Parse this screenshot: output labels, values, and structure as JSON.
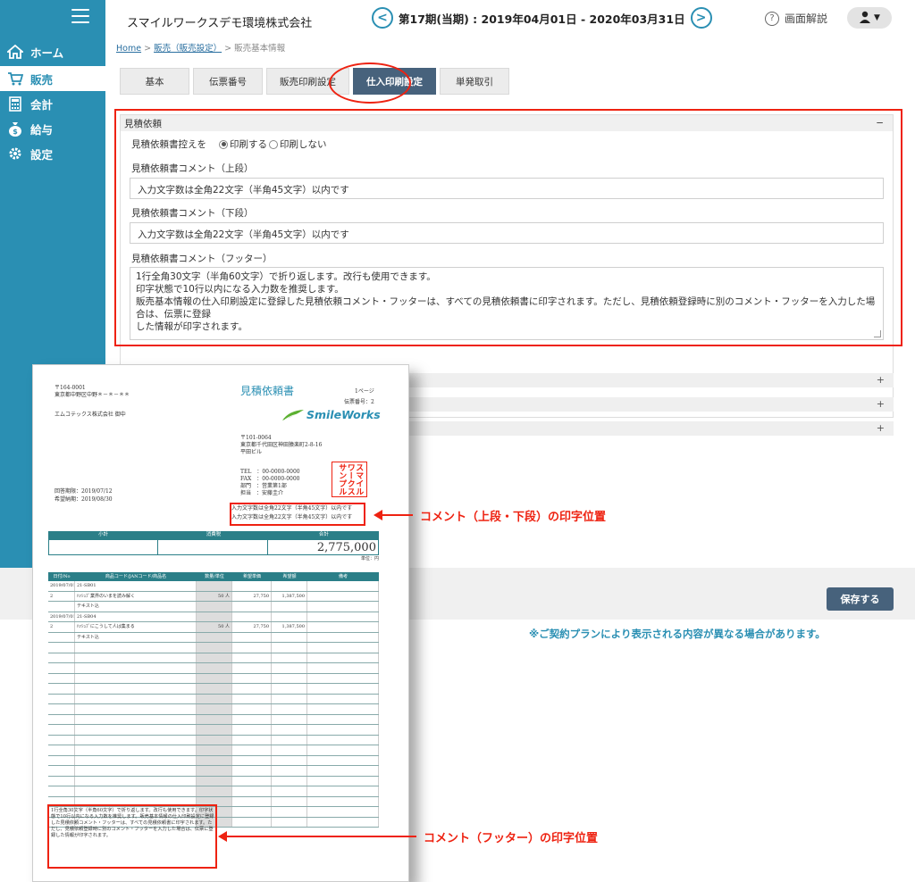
{
  "company": "スマイルワークスデモ環境株式会社",
  "period": {
    "prev_symbol": "<",
    "next_symbol": ">",
    "text": "第17期(当期) : 2019年04月01日 - 2020年03月31日"
  },
  "help_label": "画面解説",
  "sidebar": {
    "items": [
      {
        "label": "ホーム",
        "icon": "home-icon"
      },
      {
        "label": "販売",
        "icon": "cart-icon"
      },
      {
        "label": "会計",
        "icon": "calculator-icon"
      },
      {
        "label": "給与",
        "icon": "money-bag-icon"
      },
      {
        "label": "設定",
        "icon": "gear-icon"
      }
    ]
  },
  "breadcrumb": {
    "home": "Home",
    "sep": ">",
    "sales_settings": "販売（販売設定）",
    "current": "販売基本情報"
  },
  "tabs": [
    "基本",
    "伝票番号",
    "販売印刷設定",
    "仕入印刷設定",
    "単発取引"
  ],
  "section": {
    "title": "見積依頼",
    "collapse_symbol": "−",
    "print_copy_label": "見積依頼書控えを",
    "radio_print": "印刷する",
    "radio_noprint": "印刷しない",
    "comment_top_label": "見積依頼書コメント（上段）",
    "comment_top_value": "入力文字数は全角22文字（半角45文字）以内です",
    "comment_bottom_label": "見積依頼書コメント（下段）",
    "comment_bottom_value": "入力文字数は全角22文字（半角45文字）以内です",
    "footer_label": "見積依頼書コメント（フッター）",
    "footer_lines": [
      "1行全角30文字（半角60文字）で折り返します。改行も使用できます。",
      "印字状態で10行以内になる入力数を推奨します。",
      "販売基本情報の仕入印刷設定に登録した見積依頼コメント・フッターは、すべての見積依頼書に印字されます。ただし、見積依頼登録時に別のコメント・フッターを入力した場合は、伝票に登録",
      "した情報が印字されます。"
    ]
  },
  "expand_symbol": "+",
  "save_label": "保存する",
  "note": "※ご契約プランにより表示される内容が異なる場合があります。",
  "doc": {
    "zip_left": "〒164-0001",
    "addr_left": "東京都中野区中野＊－＊－＊＊",
    "client": "エムコテックス株式会社 御中",
    "title": "見積依頼書",
    "page": "1ページ",
    "slip_no": "伝票番号：2",
    "logo": "SmileWorks",
    "zip_right": "〒101-0064",
    "addr_right": "東京都千代田区神田猿楽町2-8-16",
    "bldg": "平田ビル",
    "tel": "TEL　：00-0000-0000",
    "fax": "FAX　：00-0000-0000",
    "dept": "部門　：営業第1部",
    "staff": "担当　：安藤圭介",
    "stamp": "スマイルワークスサンプル",
    "reply_date": "回答期限：2019/07/12",
    "desired_date": "希望納期：2019/08/30",
    "comment1": "入力文字数は全角22文字（半角45文字）以内です",
    "comment2": "入力文字数は全角22文字（半角45文字）以内です",
    "sum_headers": [
      "小計",
      "消費税",
      "合計"
    ],
    "total": "2,775,000",
    "unit": "単位：円",
    "detail_headers": [
      "日付/No",
      "商品コード/JANコード/商品名",
      "数量/単位",
      "希望単価",
      "希望額",
      "備考"
    ],
    "rows": [
      [
        "2019/07/01",
        "21-SB01",
        "",
        "",
        "",
        ""
      ],
      [
        "2",
        "ﾊｯｼｭﾌﾞ業界のいまを読み解く",
        "50 人",
        "27,750",
        "1,387,500",
        ""
      ],
      [
        "",
        "テキスト込",
        "",
        "",
        "",
        ""
      ],
      [
        "2019/07/01",
        "21-SB04",
        "",
        "",
        "",
        ""
      ],
      [
        "2",
        "ﾊｯｼｭﾌﾞにこうして人は集まる",
        "50 人",
        "27,750",
        "1,387,500",
        ""
      ],
      [
        "",
        "テキスト込",
        "",
        "",
        "",
        ""
      ]
    ],
    "footer_text": "1行全角30文字（半角60文字）で折り返します。改行も使用できます。印字状態で10行以内になる入力数を推奨します。販売基本情報の仕入印刷設定に登録した見積依頼コメント・フッターは、すべての見積依頼書に印字されます。ただし、見積依頼登録時に別のコメント・フッターを入力した場合は、伝票に登録した情報が印字されます。"
  },
  "callouts": {
    "top": "コメント（上段・下段）の印字位置",
    "footer": "コメント（フッター）の印字位置"
  }
}
